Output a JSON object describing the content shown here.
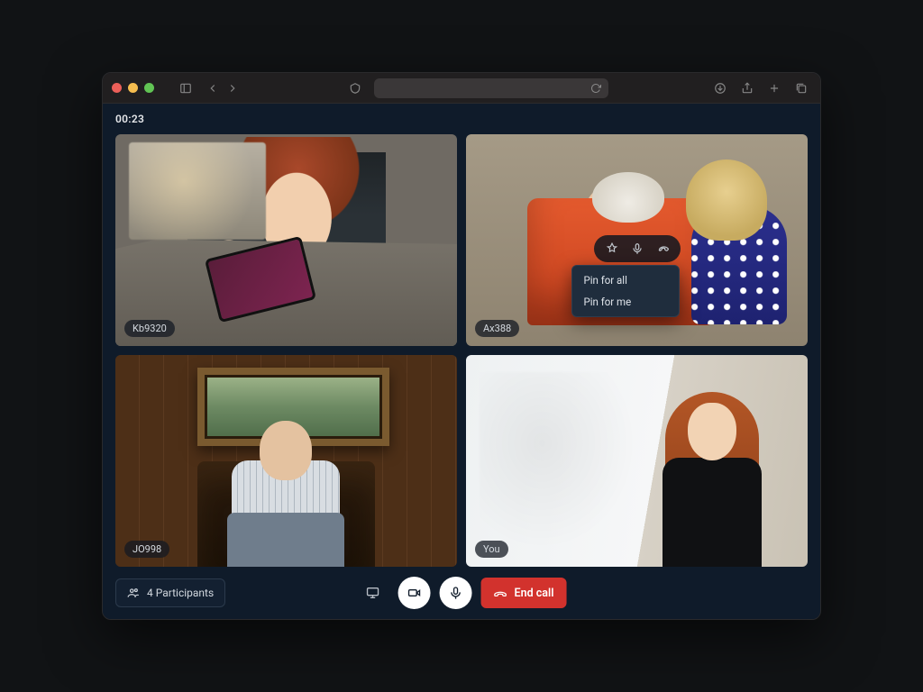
{
  "call": {
    "timer": "00:23",
    "participants_label": "4 Participants",
    "end_call_label": "End call"
  },
  "tiles": [
    {
      "name": "Kb9320"
    },
    {
      "name": "Ax388"
    },
    {
      "name": "JO998"
    },
    {
      "name": "You"
    }
  ],
  "pin_menu": {
    "options": [
      "Pin for all",
      "Pin for me"
    ]
  }
}
